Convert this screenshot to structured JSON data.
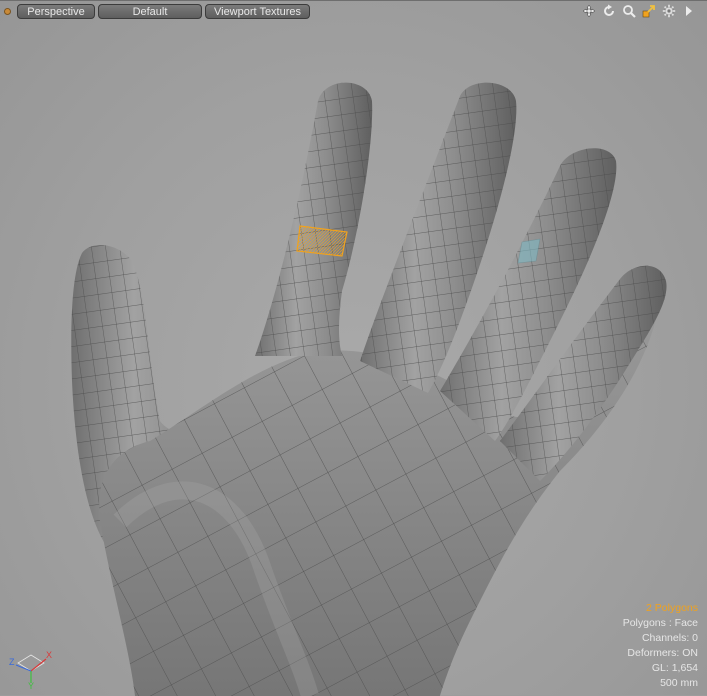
{
  "toolbar": {
    "status_dot_color": "#c98a38",
    "view_mode": "Perspective",
    "shading_preset": "Default",
    "texture_mode": "Viewport Textures",
    "tools": [
      "move-view-icon",
      "rotate-view-icon",
      "zoom-view-icon",
      "maximize-view-icon",
      "settings-gear-icon",
      "more-arrow-icon"
    ]
  },
  "info_overlay": {
    "selection": "2 Polygons",
    "mode": "Polygons : Face",
    "channels": "Channels: 0",
    "deformers": "Deformers: ON",
    "gl": "GL: 1,654",
    "scale": "500 mm"
  },
  "axis_gizmo": {
    "x": "X",
    "y": "Y",
    "z": "Z"
  },
  "colors": {
    "selection_orange": "#f0a21e",
    "highlight_cyan": "#7fb9c4",
    "mesh_gray": "#8a8a8a",
    "viewport_bg": "#a0a0a0"
  }
}
